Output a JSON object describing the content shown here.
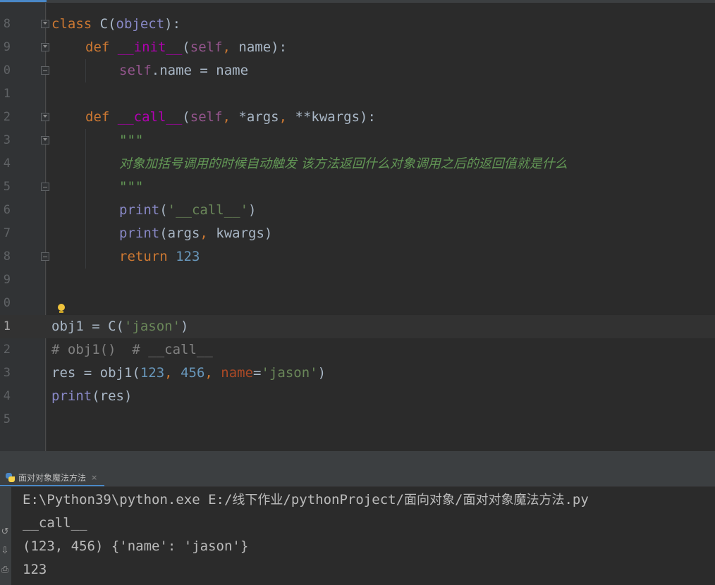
{
  "editor": {
    "lines": [
      {
        "num": "8"
      },
      {
        "num": "9"
      },
      {
        "num": "0"
      },
      {
        "num": "1"
      },
      {
        "num": "2"
      },
      {
        "num": "3"
      },
      {
        "num": "4"
      },
      {
        "num": "5"
      },
      {
        "num": "6"
      },
      {
        "num": "7"
      },
      {
        "num": "8"
      },
      {
        "num": "9"
      },
      {
        "num": "0"
      },
      {
        "num": "1"
      },
      {
        "num": "2"
      },
      {
        "num": "3"
      },
      {
        "num": "4"
      },
      {
        "num": "5"
      }
    ],
    "code": {
      "l1_kw": "class",
      "l1_rest": " C(",
      "l1_obj": "object",
      "l1_end": "):",
      "l2_kw": "def",
      "l2_fn": "__init__",
      "l2_open": "(",
      "l2_self": "self",
      "l2_comma": ",",
      "l2_rest": " name):",
      "l3_self": "self",
      "l3_rest": ".name = name",
      "l5_kw": "def",
      "l5_fn": "__call__",
      "l5_open": "(",
      "l5_self": "self",
      "l5_c1": ",",
      "l5_mid": " *args",
      "l5_c2": ",",
      "l5_end": " **kwargs):",
      "l6_doc": "\"\"\"",
      "l7_doc": "对象加括号调用的时候自动触发 该方法返回什么对象调用之后的返回值就是什么",
      "l8_doc": "\"\"\"",
      "l9_fn": "print",
      "l9_open": "(",
      "l9_str": "'__call__'",
      "l9_close": ")",
      "l10_fn": "print",
      "l10_a": "(args",
      "l10_comma": ",",
      "l10_b": " kwargs)",
      "l11_kw": "return",
      "l11_num": "123",
      "l14_a": "obj1 = C(",
      "l14_str": "'jason'",
      "l14_close": ")",
      "l15_cmt": "# obj1()  # __call__",
      "l16_a": "res = obj1(",
      "l16_n1": "123",
      "l16_c1": ",",
      "l16_n2": " 456",
      "l16_c2": ",",
      "l16_param": " name",
      "l16_eq": "=",
      "l16_str": "'jason'",
      "l16_close": ")",
      "l17_fn": "print",
      "l17_rest": "(res)"
    }
  },
  "run_panel": {
    "tab_label": "面对对象魔法方法",
    "close_glyph": "×",
    "output": {
      "line1_prefix": "E:\\Python39\\python.exe E:/",
      "line1_cn1": "线下作业",
      "line1_mid": "/pythonProject/",
      "line1_cn2": "面向对象",
      "line1_slash": "/",
      "line1_cn3": "面对对象魔法方法",
      "line1_ext": ".py",
      "line2": "__call__",
      "line3": "(123, 456) {'name': 'jason'}",
      "line4": "123"
    }
  },
  "icons": {
    "fold": "fold-marker-icon",
    "bulb": "lightbulb-icon",
    "python": "python-file-icon",
    "side": [
      "rerun-icon",
      "scroll-to-end-icon",
      "print-icon"
    ]
  },
  "colors": {
    "background": "#2b2b2b",
    "keyword": "#cc7832",
    "function": "#ffc66d",
    "string": "#6a8759",
    "number": "#6897bb",
    "comment": "#808080",
    "docstring": "#629755",
    "self": "#94558d",
    "builtin": "#8888c6"
  }
}
